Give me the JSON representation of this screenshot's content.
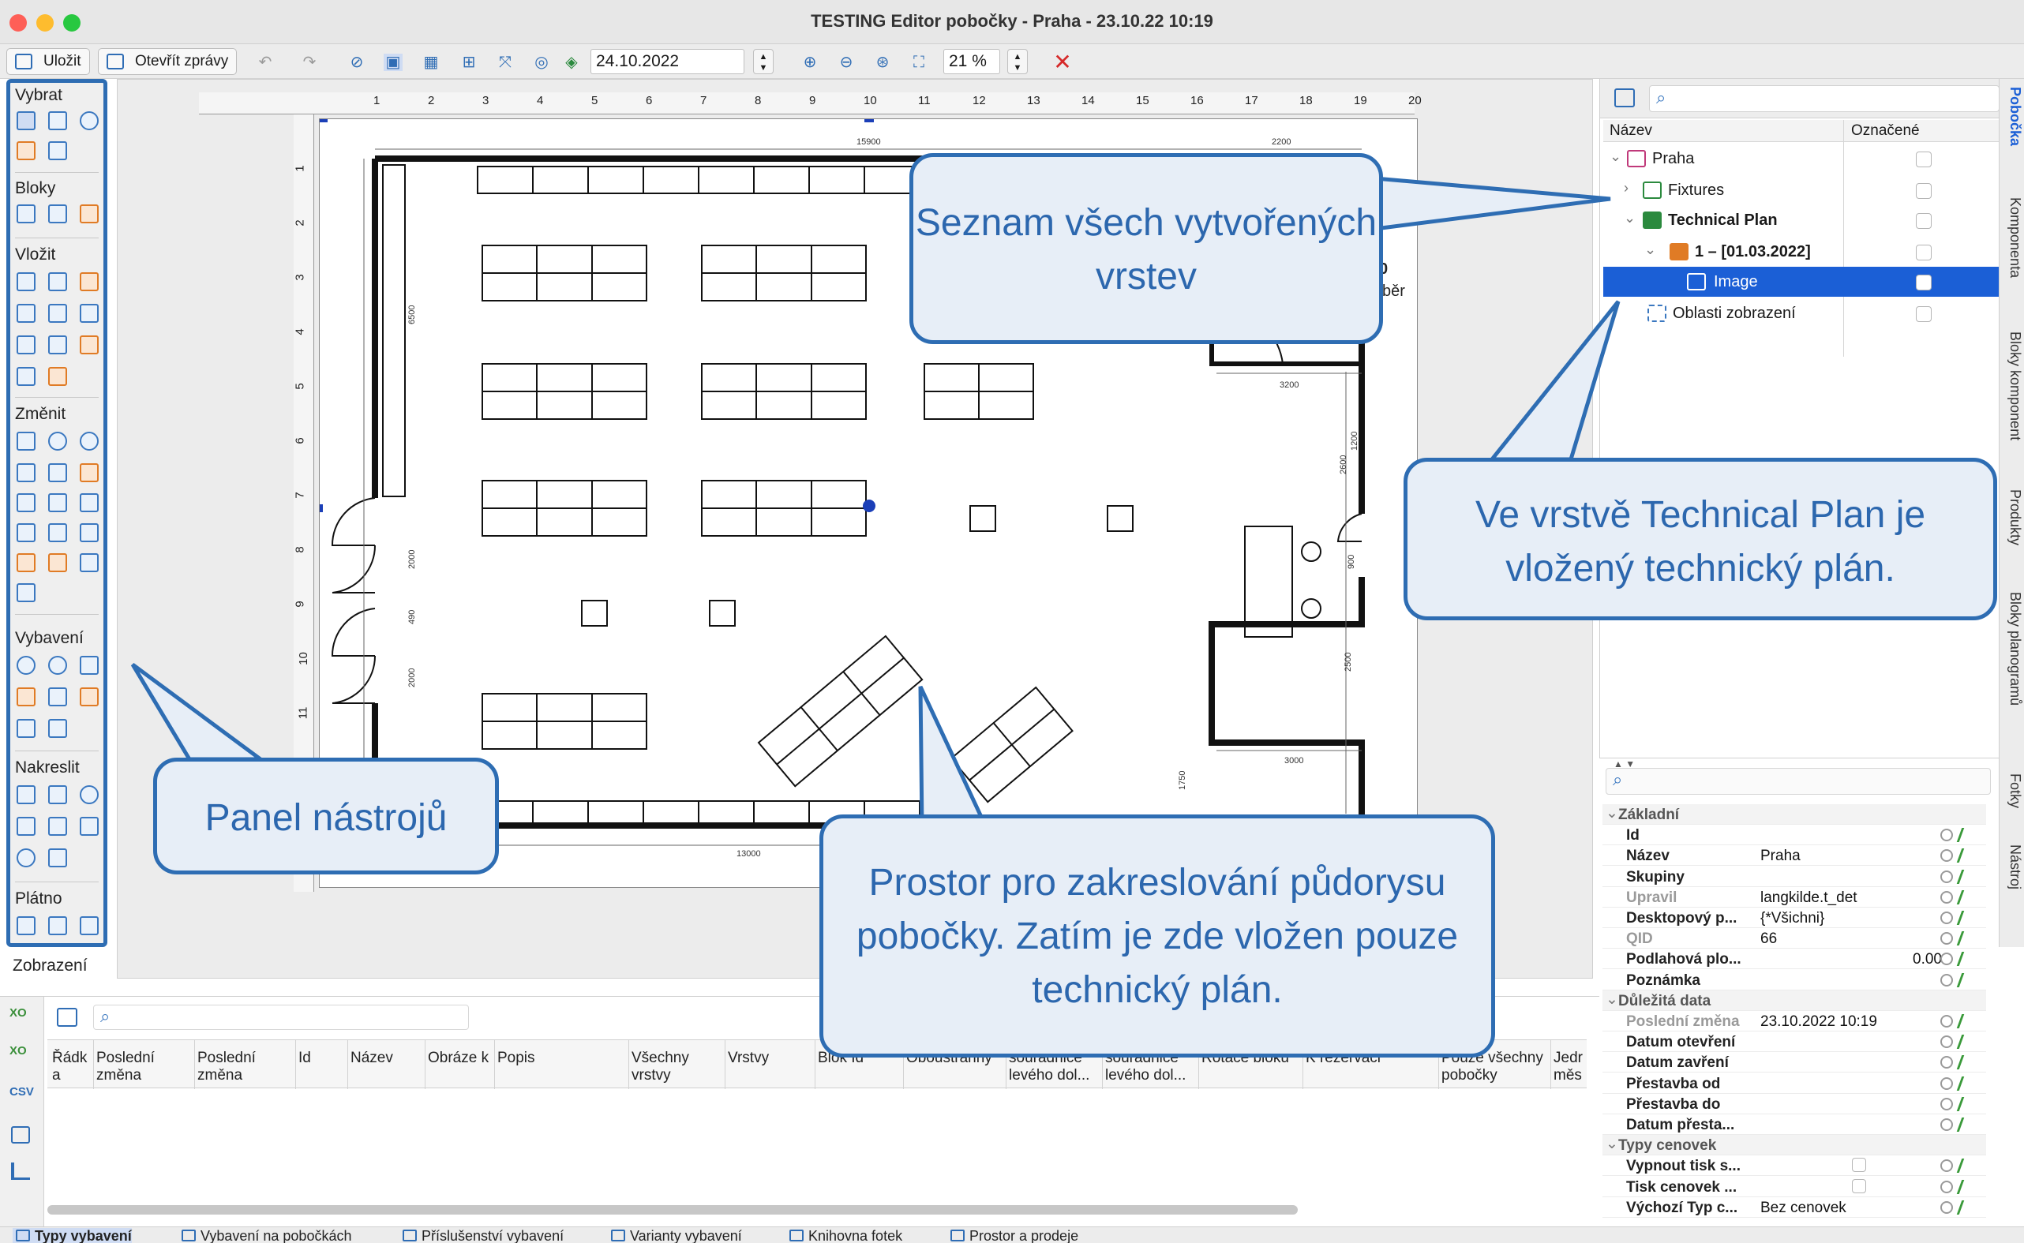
{
  "window": {
    "title": "TESTING Editor pobočky - Praha - 23.10.22 10:19"
  },
  "toolbar": {
    "save_label": "Uložit",
    "open_reports_label": "Otevřít zprávy",
    "date_value": "24.10.2022",
    "zoom_value": "21 %",
    "icons": [
      "undo-icon",
      "redo-icon",
      "rotate-icon",
      "select-mode-icon",
      "grid-icon",
      "layout-icon",
      "connect-icon",
      "camera-icon",
      "layers-icon",
      "zoom-in-icon",
      "zoom-out-icon",
      "zoom-fit-icon",
      "zoom-reset-icon",
      "close-icon"
    ]
  },
  "tools": {
    "sections": [
      "Vybrat",
      "Bloky",
      "Vložit",
      "Změnit",
      "Vybavení",
      "Nakreslit",
      "Plátno"
    ],
    "footer": "Zobrazení"
  },
  "ruler": {
    "top": [
      "1",
      "2",
      "3",
      "4",
      "5",
      "6",
      "7",
      "8",
      "9",
      "10",
      "11",
      "12",
      "13",
      "14",
      "15",
      "16",
      "17",
      "18",
      "19",
      "20"
    ],
    "left": [
      "1",
      "2",
      "3",
      "4",
      "5",
      "6",
      "7",
      "8",
      "9",
      "10",
      "11",
      "12"
    ]
  },
  "plan": {
    "dims": [
      "15900",
      "2200",
      "6500",
      "3200",
      "1400",
      "2000",
      "1200",
      "490",
      "2000",
      "2600",
      "900",
      "2500",
      "3000",
      "1750",
      "13000"
    ],
    "partial_text": [
      "0",
      "ýběr"
    ]
  },
  "layers": {
    "col_name": "Název",
    "col_marked": "Označené",
    "rows": [
      {
        "label": "Praha",
        "icon": "store-icon"
      },
      {
        "label": "Fixtures",
        "icon": "layers-icon"
      },
      {
        "label": "Technical Plan",
        "icon": "layers-icon"
      },
      {
        "label": "1 – [01.03.2022]",
        "icon": "layer-stack-icon"
      },
      {
        "label": "Image",
        "icon": "image-icon"
      },
      {
        "label": "Oblasti zobrazení",
        "icon": "display-areas-icon"
      }
    ]
  },
  "properties": {
    "rows": [
      {
        "type": "section",
        "key": "Základní"
      },
      {
        "key": "Id",
        "value": ""
      },
      {
        "key": "Název",
        "value": "Praha"
      },
      {
        "key": "Skupiny",
        "value": ""
      },
      {
        "key": "Upravil",
        "value": "langkilde.t_det",
        "dim": true
      },
      {
        "key": "Desktopový p...",
        "value": "{*Všichni}"
      },
      {
        "key": "QID",
        "value": "66",
        "dim": true
      },
      {
        "key": "Podlahová plo...",
        "value": "0.00",
        "num": true
      },
      {
        "key": "Poznámka",
        "value": ""
      },
      {
        "type": "section",
        "key": "Důležitá data"
      },
      {
        "key": "Poslední změna",
        "value": "23.10.2022 10:19",
        "dim": true
      },
      {
        "key": "Datum otevření",
        "value": ""
      },
      {
        "key": "Datum zavření",
        "value": ""
      },
      {
        "key": "Přestavba od",
        "value": ""
      },
      {
        "key": "Přestavba do",
        "value": ""
      },
      {
        "key": "Datum přesta...",
        "value": ""
      },
      {
        "type": "section",
        "key": "Typy cenovek"
      },
      {
        "key": "Vypnout tisk s...",
        "value": "",
        "checkbox": true
      },
      {
        "key": "Tisk cenovek ...",
        "value": "",
        "checkbox": true
      },
      {
        "key": "Výchozí Typ c...",
        "value": "Bez cenovek"
      }
    ]
  },
  "side_tabs": [
    "Pobočka",
    "Komponenta",
    "Bloky komponent",
    "Produkty",
    "Bloky planogramů",
    "Fotky",
    "Nástroj"
  ],
  "table": {
    "columns": [
      "Řádk a",
      "Poslední změna",
      "Poslední změna",
      "Id",
      "Název",
      "Obráze k",
      "Popis",
      "Všechny vrstvy",
      "Vrstvy",
      "Blok Id",
      "Oboustranný",
      "souřadnice levého dol...",
      "souřadnice levého dol...",
      "Rotace bloku",
      "K rezervaci",
      "Pouze všechny pobočky",
      "Jedr měs"
    ],
    "side_buttons": [
      "XO",
      "XO",
      "CSV"
    ]
  },
  "bottom_tabs": [
    "Typy vybavení",
    "Vybavení na pobočkách",
    "Příslušenství vybavení",
    "Varianty vybavení",
    "Knihovna fotek",
    "Prostor a prodeje"
  ],
  "callouts": {
    "layers": "Seznam všech vytvořených vrstev",
    "technical": "Ve vrstvě Technical Plan je vložený technický plán.",
    "tools": "Panel nástrojů",
    "canvas": "Prostor pro zakreslování půdorysu pobočky. Zatím je zde vložen pouze technický plán."
  },
  "colors": {
    "accent": "#2e6db3",
    "callout_bg": "#e7eef7",
    "selection": "#1b5fd6"
  }
}
